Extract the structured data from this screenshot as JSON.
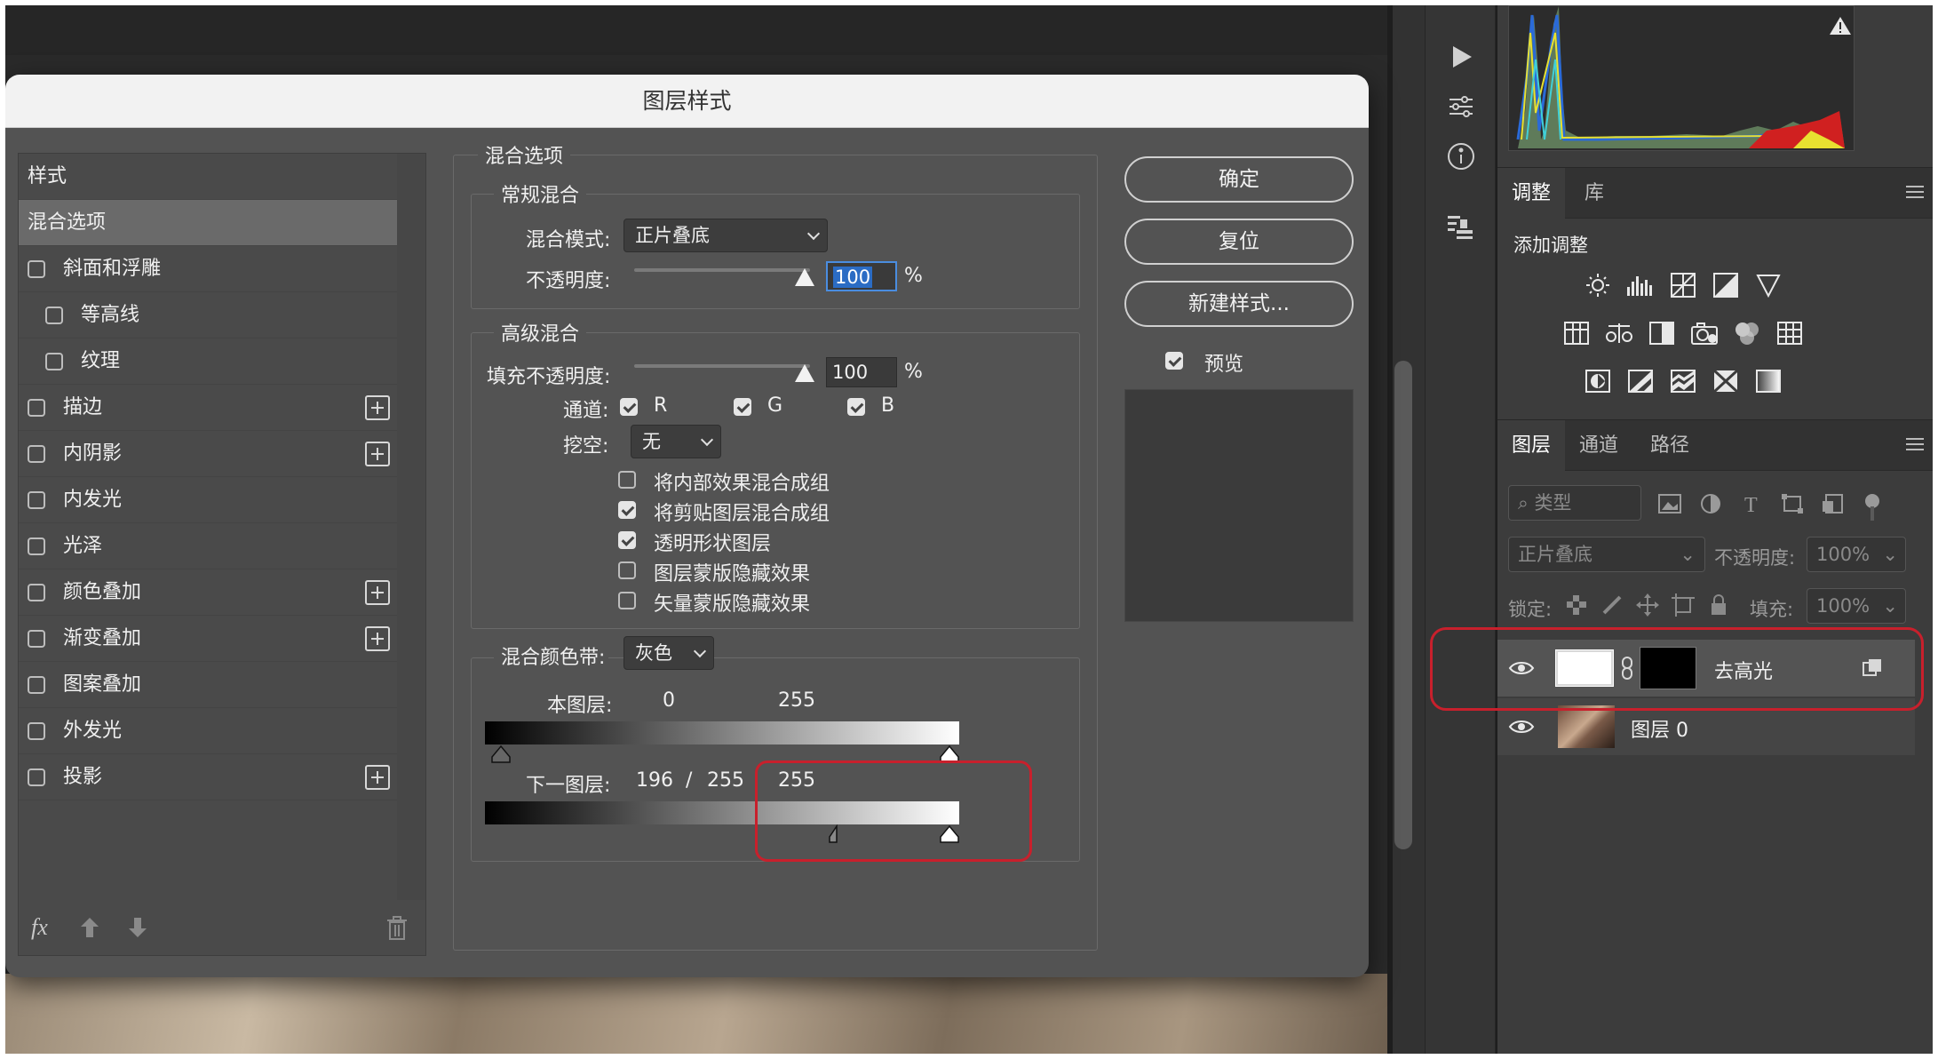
{
  "dialog": {
    "title": "图层样式",
    "buttons": {
      "ok": "确定",
      "reset": "复位",
      "new_style": "新建样式..."
    },
    "preview": {
      "label": "预览",
      "checked": true
    },
    "styles": {
      "header": "样式",
      "items": [
        {
          "label": "混合选项",
          "selected": true,
          "checkbox": false,
          "plus": false
        },
        {
          "label": "斜面和浮雕",
          "checkbox": true,
          "plus": false
        },
        {
          "label": "等高线",
          "checkbox": true,
          "indent": true,
          "plus": false
        },
        {
          "label": "纹理",
          "checkbox": true,
          "indent": true,
          "plus": false
        },
        {
          "label": "描边",
          "checkbox": true,
          "plus": true
        },
        {
          "label": "内阴影",
          "checkbox": true,
          "plus": true
        },
        {
          "label": "内发光",
          "checkbox": true,
          "plus": false
        },
        {
          "label": "光泽",
          "checkbox": true,
          "plus": false
        },
        {
          "label": "颜色叠加",
          "checkbox": true,
          "plus": true
        },
        {
          "label": "渐变叠加",
          "checkbox": true,
          "plus": true
        },
        {
          "label": "图案叠加",
          "checkbox": true,
          "plus": false
        },
        {
          "label": "外发光",
          "checkbox": true,
          "plus": false
        },
        {
          "label": "投影",
          "checkbox": true,
          "plus": true
        }
      ],
      "footer_fx": "fx"
    },
    "blend": {
      "title": "混合选项",
      "general": {
        "title": "常规混合",
        "mode_label": "混合模式:",
        "mode_value": "正片叠底",
        "opacity_label": "不透明度:",
        "opacity_value": "100",
        "percent": "%"
      },
      "advanced": {
        "title": "高级混合",
        "fill_label": "填充不透明度:",
        "fill_value": "100",
        "percent": "%",
        "channels_label": "通道:",
        "channels": [
          "R",
          "G",
          "B"
        ],
        "knockout_label": "挖空:",
        "knockout_value": "无",
        "options": [
          {
            "label": "将内部效果混合成组",
            "checked": false
          },
          {
            "label": "将剪贴图层混合成组",
            "checked": true
          },
          {
            "label": "透明形状图层",
            "checked": true
          },
          {
            "label": "图层蒙版隐藏效果",
            "checked": false
          },
          {
            "label": "矢量蒙版隐藏效果",
            "checked": false
          }
        ]
      },
      "blend_if": {
        "label": "混合颜色带:",
        "value": "灰色",
        "this_layer": {
          "label": "本图层:",
          "low": "0",
          "high": "255"
        },
        "underlying": {
          "label": "下一图层:",
          "low": "196",
          "sep": "/",
          "low2": "255",
          "high": "255"
        }
      }
    }
  },
  "right_panel": {
    "adjust_tabs": [
      "调整",
      "库"
    ],
    "add_adjustment": "添加调整",
    "layer_tabs": [
      "图层",
      "通道",
      "路径"
    ],
    "filter_kind": "类型",
    "blend_mode": "正片叠底",
    "opacity_label": "不透明度:",
    "opacity_value": "100%",
    "lock_label": "锁定:",
    "fill_label": "填充:",
    "fill_value": "100%",
    "layers": [
      {
        "name": "去高光",
        "selected": true
      },
      {
        "name": "图层 0",
        "selected": false
      }
    ]
  },
  "colors": {
    "highlight_red": "#c8202c",
    "dialog_bg": "#535353",
    "panel_bg": "#3c3c3c"
  }
}
